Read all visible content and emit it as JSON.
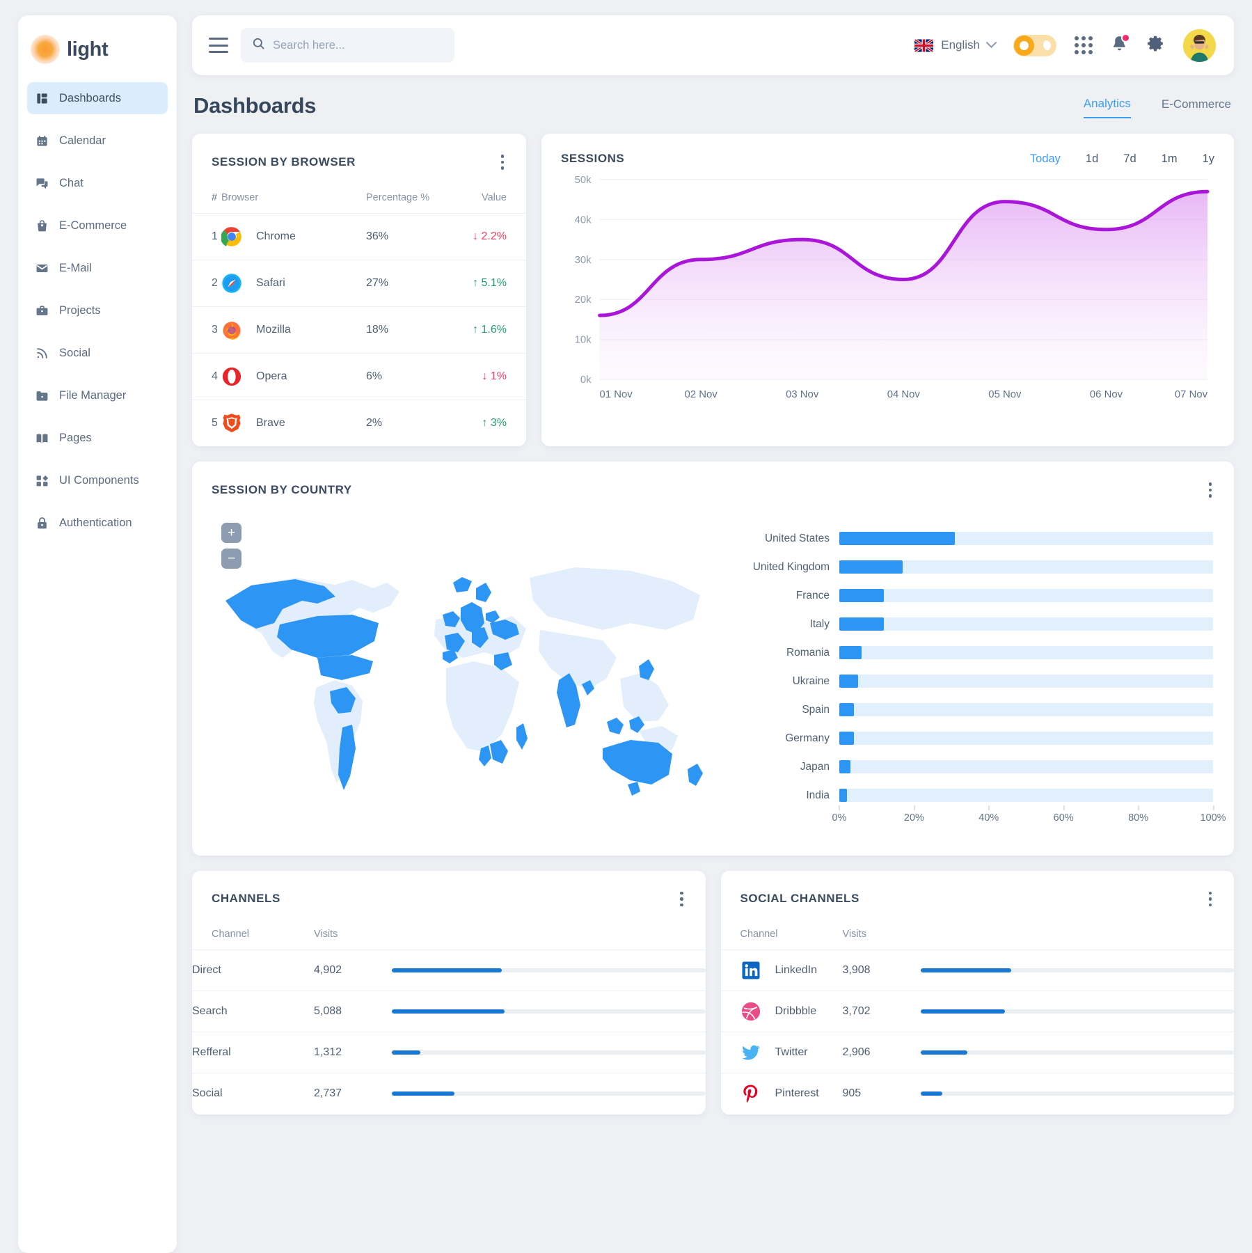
{
  "brand": {
    "name": "light",
    "logo_icon": "sun-burst-logo"
  },
  "sidebar": {
    "items": [
      {
        "label": "Dashboards",
        "icon": "dashboard-icon",
        "active": true
      },
      {
        "label": "Calendar",
        "icon": "calendar-icon",
        "active": false
      },
      {
        "label": "Chat",
        "icon": "chat-icon",
        "active": false
      },
      {
        "label": "E-Commerce",
        "icon": "shopping-bag-icon",
        "active": false
      },
      {
        "label": "E-Mail",
        "icon": "mail-icon",
        "active": false
      },
      {
        "label": "Projects",
        "icon": "briefcase-icon",
        "active": false
      },
      {
        "label": "Social",
        "icon": "rss-icon",
        "active": false
      },
      {
        "label": "File Manager",
        "icon": "folder-icon",
        "active": false
      },
      {
        "label": "Pages",
        "icon": "book-icon",
        "active": false
      },
      {
        "label": "UI Components",
        "icon": "components-icon",
        "active": false
      },
      {
        "label": "Authentication",
        "icon": "lock-icon",
        "active": false
      }
    ]
  },
  "topbar": {
    "menu_icon": "hamburger-icon",
    "search": {
      "placeholder": "Search here...",
      "value": "",
      "icon": "search-icon"
    },
    "language": {
      "label": "English",
      "flag": "uk-flag-icon",
      "chevron": "chevron-down-icon"
    },
    "theme_toggle": {
      "state": "light",
      "sun_icon": "sun-icon",
      "moon_icon": "moon-icon"
    },
    "apps_icon": "apps-grid-icon",
    "notifications": {
      "icon": "bell-icon",
      "has_badge": true
    },
    "settings_icon": "gear-icon",
    "avatar": "user-avatar"
  },
  "page": {
    "title": "Dashboards",
    "tabs": [
      {
        "label": "Analytics",
        "active": true
      },
      {
        "label": "E-Commerce",
        "active": false
      }
    ]
  },
  "browser_card": {
    "title": "SESSION BY BROWSER",
    "menu_icon": "kebab-menu-icon",
    "columns": [
      "#",
      "Browser",
      "Percentage %",
      "Value"
    ],
    "rows": [
      {
        "idx": "1",
        "browser": "Chrome",
        "icon": "chrome-icon",
        "percentage": "36%",
        "value": "2.2%",
        "trend": "down"
      },
      {
        "idx": "2",
        "browser": "Safari",
        "icon": "safari-icon",
        "percentage": "27%",
        "value": "5.1%",
        "trend": "up"
      },
      {
        "idx": "3",
        "browser": "Mozilla",
        "icon": "firefox-icon",
        "percentage": "18%",
        "value": "1.6%",
        "trend": "up"
      },
      {
        "idx": "4",
        "browser": "Opera",
        "icon": "opera-icon",
        "percentage": "6%",
        "value": "1%",
        "trend": "down"
      },
      {
        "idx": "5",
        "browser": "Brave",
        "icon": "brave-icon",
        "percentage": "2%",
        "value": "3%",
        "trend": "up"
      }
    ]
  },
  "sessions_card": {
    "title": "SESSIONS",
    "ranges": [
      {
        "label": "Today",
        "active": true
      },
      {
        "label": "1d",
        "active": false
      },
      {
        "label": "7d",
        "active": false
      },
      {
        "label": "1m",
        "active": false
      },
      {
        "label": "1y",
        "active": false
      }
    ]
  },
  "country_card": {
    "title": "SESSION BY COUNTRY",
    "menu_icon": "kebab-menu-icon",
    "zoom_in": "+",
    "zoom_out": "−",
    "map_icon": "world-map"
  },
  "channels_card": {
    "title": "CHANNELS",
    "menu_icon": "kebab-menu-icon",
    "columns": [
      "Channel",
      "Visits"
    ],
    "rows": [
      {
        "channel": "Direct",
        "visits": "4,902",
        "pct": 35
      },
      {
        "channel": "Search",
        "visits": "5,088",
        "pct": 36
      },
      {
        "channel": "Refferal",
        "visits": "1,312",
        "pct": 9
      },
      {
        "channel": "Social",
        "visits": "2,737",
        "pct": 20
      }
    ]
  },
  "social_card": {
    "title": "SOCIAL CHANNELS",
    "menu_icon": "kebab-menu-icon",
    "columns": [
      "Channel",
      "Visits"
    ],
    "rows": [
      {
        "channel": "LinkedIn",
        "icon": "linkedin-icon",
        "visits": "3,908",
        "pct": 29
      },
      {
        "channel": "Dribbble",
        "icon": "dribbble-icon",
        "visits": "3,702",
        "pct": 27
      },
      {
        "channel": "Twitter",
        "icon": "twitter-icon",
        "visits": "2,906",
        "pct": 15
      },
      {
        "channel": "Pinterest",
        "icon": "pinterest-icon",
        "visits": "905",
        "pct": 7
      }
    ]
  },
  "colors": {
    "accent_blue": "#2d95f4",
    "bar_blue": "#1878d3",
    "track_blue": "#e2f0fd",
    "line_purple": "#a916d9",
    "up_green": "#22a06b",
    "down_red": "#ef3d63",
    "bg": "#eef0f4"
  },
  "chart_data": [
    {
      "type": "area",
      "title": "SESSIONS",
      "x": [
        "01 Nov",
        "02 Nov",
        "03 Nov",
        "04 Nov",
        "05 Nov",
        "06 Nov",
        "07 Nov"
      ],
      "values": [
        16000,
        30000,
        35000,
        25000,
        44500,
        37500,
        47000
      ],
      "ytick_labels": [
        "0k",
        "10k",
        "20k",
        "30k",
        "40k",
        "50k"
      ],
      "ylim": [
        0,
        50000
      ],
      "xlabel": "",
      "ylabel": "",
      "grid": true,
      "legend": "none",
      "line_color": "#a916d9",
      "fill": "purple-gradient"
    },
    {
      "type": "bar",
      "orientation": "horizontal",
      "title": "SESSION BY COUNTRY",
      "categories": [
        "United States",
        "United Kingdom",
        "France",
        "Italy",
        "Romania",
        "Ukraine",
        "Spain",
        "Germany",
        "Japan",
        "India"
      ],
      "values": [
        31,
        17,
        12,
        12,
        6,
        5,
        4,
        4,
        3,
        2
      ],
      "xtick_labels": [
        "0%",
        "20%",
        "40%",
        "60%",
        "80%",
        "100%"
      ],
      "xlim": [
        0,
        100
      ],
      "xlabel": "",
      "ylabel": "",
      "grid": false,
      "legend": "none",
      "bar_color": "#2d95f4",
      "track_color": "#e2f0fd"
    }
  ]
}
